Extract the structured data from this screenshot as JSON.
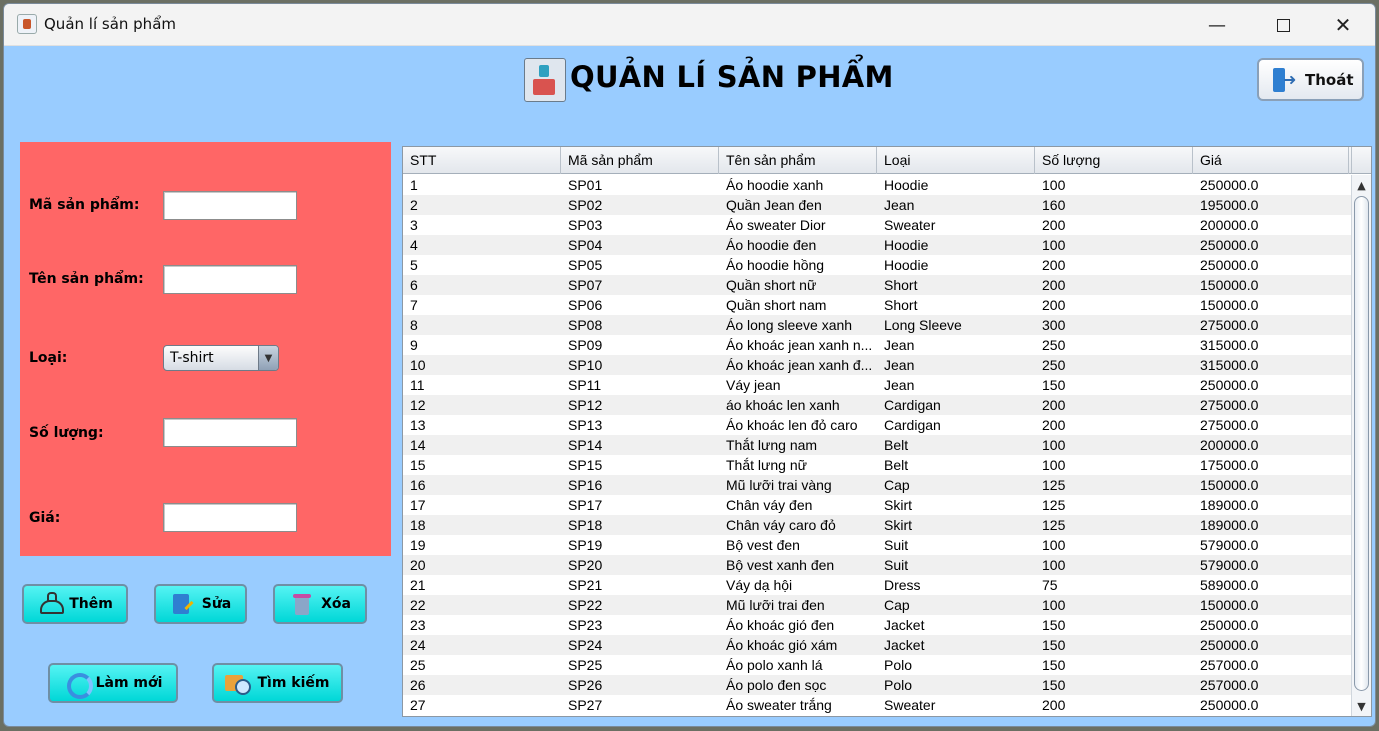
{
  "window": {
    "title": "Quản lí sản phẩm",
    "minimize_glyph": "—",
    "close_glyph": "✕"
  },
  "header": {
    "title": "QUẢN LÍ SẢN PHẨM",
    "icon": "product-box-icon",
    "exit_label": "Thoát",
    "exit_icon": "exit-door-icon"
  },
  "form": {
    "ma_label": "Mã sản phẩm:",
    "ten_label": "Tên sản phẩm:",
    "loai_label": "Loại:",
    "loai_value": "T-shirt",
    "so_luong_label": "Số lượng:",
    "gia_label": "Giá:",
    "ma_value": "",
    "ten_value": "",
    "so_luong_value": "",
    "gia_value": "",
    "dropdown_glyph": "▼",
    "panel_color": "#ff6666"
  },
  "actions": {
    "them": "Thêm",
    "sua": "Sửa",
    "xoa": "Xóa",
    "lam_moi": "Làm mới",
    "tim_kiem": "Tìm kiếm"
  },
  "table": {
    "headers": [
      "STT",
      "Mã sản phẩm",
      "Tên sản phẩm",
      "Loại",
      "Số lượng",
      "Giá"
    ],
    "rows": [
      [
        "1",
        "SP01",
        "Áo hoodie xanh",
        "Hoodie",
        "100",
        "250000.0"
      ],
      [
        "2",
        "SP02",
        "Quần Jean đen",
        "Jean",
        "160",
        "195000.0"
      ],
      [
        "3",
        "SP03",
        "Áo sweater Dior",
        "Sweater",
        "200",
        "200000.0"
      ],
      [
        "4",
        "SP04",
        "Áo hoodie đen",
        "Hoodie",
        "100",
        "250000.0"
      ],
      [
        "5",
        "SP05",
        "Áo hoodie hồng",
        "Hoodie",
        "200",
        "250000.0"
      ],
      [
        "6",
        "SP07",
        "Quần short nữ",
        "Short",
        "200",
        "150000.0"
      ],
      [
        "7",
        "SP06",
        "Quần short nam",
        "Short",
        "200",
        "150000.0"
      ],
      [
        "8",
        "SP08",
        "Áo long sleeve xanh",
        "Long Sleeve",
        "300",
        "275000.0"
      ],
      [
        "9",
        "SP09",
        "Áo khoác jean xanh n...",
        "Jean",
        "250",
        "315000.0"
      ],
      [
        "10",
        "SP10",
        "Áo khoác jean xanh đ...",
        "Jean",
        "250",
        "315000.0"
      ],
      [
        "11",
        "SP11",
        "Váy jean",
        "Jean",
        "150",
        "250000.0"
      ],
      [
        "12",
        "SP12",
        "áo khoác len xanh",
        "Cardigan",
        "200",
        "275000.0"
      ],
      [
        "13",
        "SP13",
        "Áo khoác len đỏ caro",
        "Cardigan",
        "200",
        "275000.0"
      ],
      [
        "14",
        "SP14",
        "Thắt lưng nam",
        "Belt",
        "100",
        "200000.0"
      ],
      [
        "15",
        "SP15",
        "Thắt lưng nữ",
        "Belt",
        "100",
        "175000.0"
      ],
      [
        "16",
        "SP16",
        "Mũ lưỡi trai vàng",
        "Cap",
        "125",
        "150000.0"
      ],
      [
        "17",
        "SP17",
        "Chân váy đen",
        "Skirt",
        "125",
        "189000.0"
      ],
      [
        "18",
        "SP18",
        "Chân váy caro đỏ",
        "Skirt",
        "125",
        "189000.0"
      ],
      [
        "19",
        "SP19",
        "Bộ vest đen",
        "Suit",
        "100",
        "579000.0"
      ],
      [
        "20",
        "SP20",
        "Bộ vest xanh đen",
        "Suit",
        "100",
        "579000.0"
      ],
      [
        "21",
        "SP21",
        "Váy dạ hội",
        "Dress",
        "75",
        "589000.0"
      ],
      [
        "22",
        "SP22",
        "Mũ lưỡi trai đen",
        "Cap",
        "100",
        "150000.0"
      ],
      [
        "23",
        "SP23",
        "Áo khoác gió đen",
        "Jacket",
        "150",
        "250000.0"
      ],
      [
        "24",
        "SP24",
        "Áo khoác gió xám",
        "Jacket",
        "150",
        "250000.0"
      ],
      [
        "25",
        "SP25",
        "Áo polo xanh lá",
        "Polo",
        "150",
        "257000.0"
      ],
      [
        "26",
        "SP26",
        "Áo polo đen sọc",
        "Polo",
        "150",
        "257000.0"
      ],
      [
        "27",
        "SP27",
        "Áo sweater trắng",
        "Sweater",
        "200",
        "250000.0"
      ]
    ],
    "scroll_up_glyph": "▲",
    "scroll_down_glyph": "▼"
  },
  "colors": {
    "background": "#99ccff",
    "form_panel": "#ff6666",
    "action_button": "#00e0e0"
  }
}
